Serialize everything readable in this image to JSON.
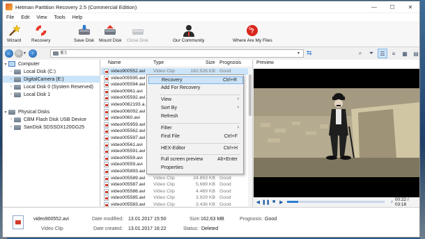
{
  "window": {
    "title": "Hetman Partition Recovery 2.5 (Commercial Edition)"
  },
  "window_controls": {
    "minimize": "—",
    "maximize": "☐",
    "close": "✕"
  },
  "menu": [
    "File",
    "Edit",
    "View",
    "Tools",
    "Help"
  ],
  "toolbar": {
    "wizard": "Wizard",
    "recovery": "Recovery",
    "save_disk": "Save Disk",
    "mount_disk": "Mount Disk",
    "close_disk": "Close Disk",
    "our_community": "Our Community",
    "where_are_my_files": "Where Are My Files"
  },
  "address": {
    "path": "E:\\"
  },
  "tree": {
    "computer_label": "Computer",
    "items": [
      {
        "label": "Local Disk (C:)"
      },
      {
        "label": "DigitalCamera (E:)"
      },
      {
        "label": "Local Disk 0 (System Reserved)"
      },
      {
        "label": "Local Disk 1"
      }
    ],
    "physical_label": "Physical Disks",
    "physical_items": [
      {
        "label": "CBM Flash Disk USB Device"
      },
      {
        "label": "SanDisk SDSSDX120GG25"
      }
    ]
  },
  "list": {
    "columns": {
      "name": "Name",
      "type": "Type",
      "size": "Size",
      "prognosis": "Prognosis"
    },
    "rows": [
      {
        "name": "video900552.avi",
        "type": "Video Clip",
        "size": "162.526 KB",
        "prognosis": "Good"
      },
      {
        "name": "video005595.avi",
        "type": "",
        "size": "",
        "prognosis": ""
      },
      {
        "name": "video005594.avi",
        "type": "",
        "size": "",
        "prognosis": ""
      },
      {
        "name": "video00961.avi",
        "type": "",
        "size": "",
        "prognosis": ""
      },
      {
        "name": "video005592.avi",
        "type": "",
        "size": "",
        "prognosis": ""
      },
      {
        "name": "video0062193.a...",
        "type": "",
        "size": "",
        "prognosis": ""
      },
      {
        "name": "video006092.avi",
        "type": "",
        "size": "",
        "prognosis": ""
      },
      {
        "name": "video0060.avi",
        "type": "",
        "size": "",
        "prognosis": ""
      },
      {
        "name": "video005959.avi",
        "type": "",
        "size": "",
        "prognosis": ""
      },
      {
        "name": "video005562.avi",
        "type": "",
        "size": "",
        "prognosis": ""
      },
      {
        "name": "video005597.avi",
        "type": "",
        "size": "",
        "prognosis": ""
      },
      {
        "name": "video00561.avi",
        "type": "",
        "size": "",
        "prognosis": ""
      },
      {
        "name": "video005591.avi",
        "type": "",
        "size": "",
        "prognosis": ""
      },
      {
        "name": "video00559.avi",
        "type": "",
        "size": "",
        "prognosis": ""
      },
      {
        "name": "video00559.avi",
        "type": "",
        "size": "",
        "prognosis": ""
      },
      {
        "name": "video005893.avi",
        "type": "",
        "size": "",
        "prognosis": ""
      },
      {
        "name": "video005589.avi",
        "type": "Video Clip",
        "size": "24.853 KB",
        "prognosis": "Good"
      },
      {
        "name": "video005587.avi",
        "type": "Video Clip",
        "size": "5.689 KB",
        "prognosis": "Good"
      },
      {
        "name": "video005586.avi",
        "type": "Video Clip",
        "size": "4.469 KB",
        "prognosis": "Good"
      },
      {
        "name": "video005585.avi",
        "type": "Video Clip",
        "size": "3.929 KB",
        "prognosis": "Good"
      },
      {
        "name": "video005583.avi",
        "type": "Video Clip",
        "size": "3.436 KB",
        "prognosis": "Good"
      }
    ]
  },
  "context_menu": {
    "recovery": "Recovery",
    "recovery_shortcut": "Ctrl+R",
    "add_for_recovery": "Add For Recovery",
    "view": "View",
    "sort_by": "Sort By",
    "refresh": "Refresh",
    "filter": "Filter",
    "find_file": "Find File",
    "find_file_shortcut": "Ctrl+F",
    "hex_editor": "HEX-Editor",
    "hex_editor_shortcut": "Ctrl+H",
    "full_screen_preview": "Full screen preview",
    "full_screen_shortcut": "Alt+Enter",
    "properties": "Properties"
  },
  "preview": {
    "label": "Preview",
    "time": "00:22 / 03:18",
    "progress_fraction": 0.11
  },
  "status": {
    "filename": "video900552.avi",
    "filetype": "Video Clip",
    "date_modified_label": "Date modified:",
    "date_modified": "13.01.2017 15:50",
    "date_created_label": "Date created:",
    "date_created": "13.01.2017 16:22",
    "size_label": "Size:",
    "size": "162,63 MB",
    "status_label": "Status:",
    "status": "Deleted",
    "prognosis_label": "Prognosis:",
    "prognosis": "Good"
  }
}
